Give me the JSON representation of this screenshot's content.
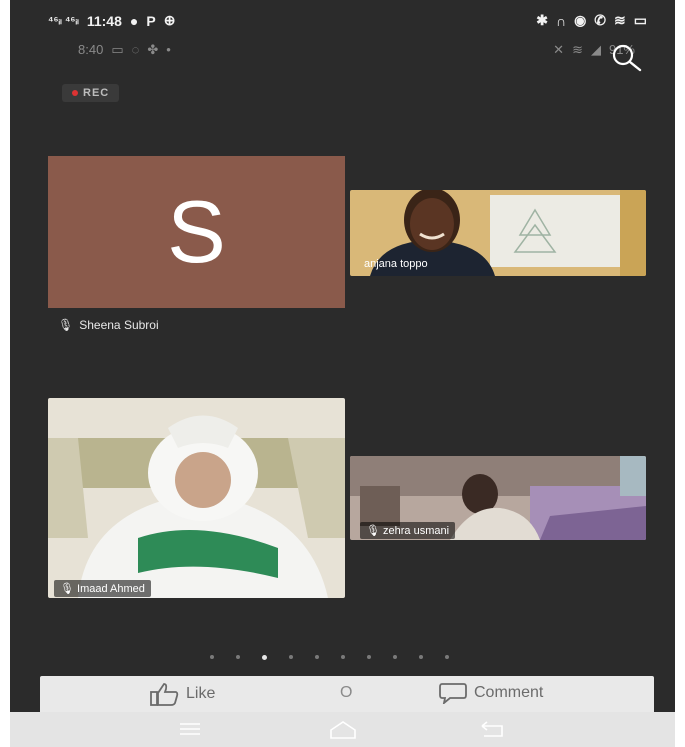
{
  "status": {
    "network_left": "⁴⁶ᵢₗ ⁴⁶ᵢₗ",
    "time": "11:48",
    "letter": "P",
    "battery_label": "▭"
  },
  "secondary_status": {
    "time": "8:40",
    "battery": "91%"
  },
  "recording": {
    "label": "REC"
  },
  "participants": [
    {
      "name": "Sheena Subroi",
      "initial": "S"
    },
    {
      "name": "anjana toppo"
    },
    {
      "name": "Imaad Ahmed"
    },
    {
      "name": "zehra usmani"
    }
  ],
  "pager": {
    "count": 10,
    "active_index": 2
  },
  "actions": {
    "like": "Like",
    "comment": "Comment",
    "center": "O"
  },
  "colors": {
    "background": "#2b2b2b",
    "avatar": "#8a5a4b"
  }
}
